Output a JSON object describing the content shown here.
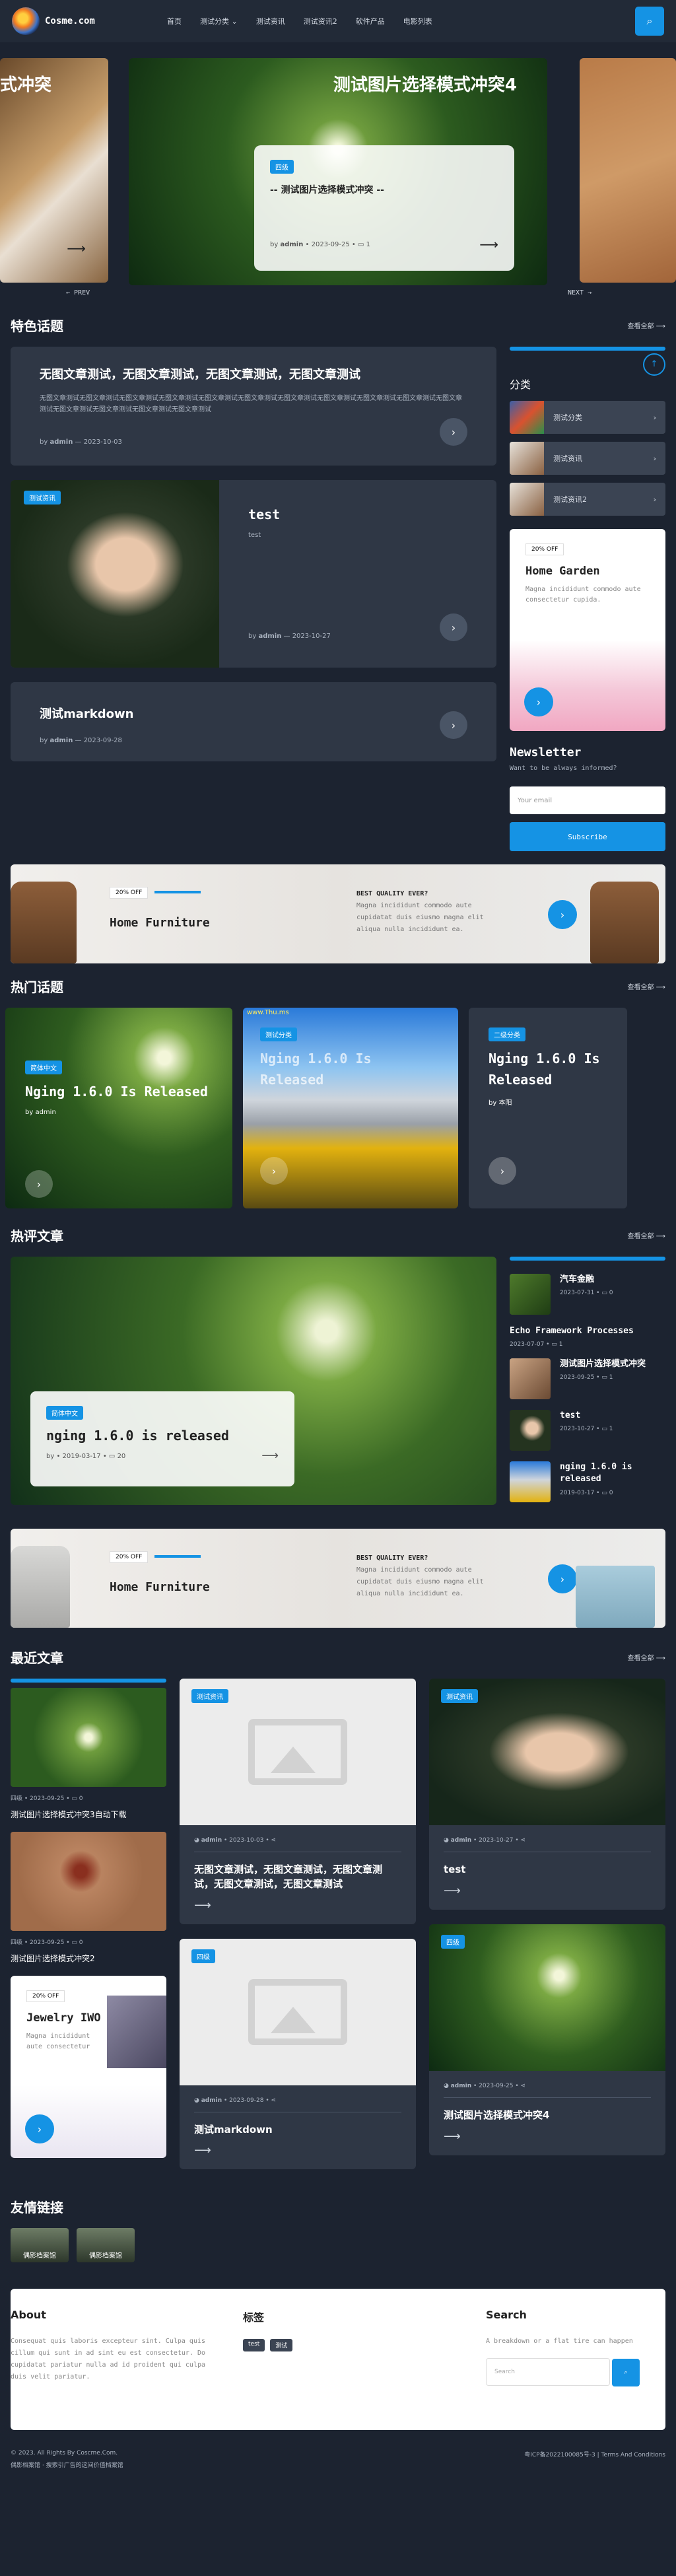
{
  "header": {
    "site_name": "Cosme.com",
    "nav": [
      "首页",
      "测试分类",
      "测试资讯",
      "测试资讯2",
      "软件产品",
      "电影列表"
    ],
    "nav_has_dropdown": [
      false,
      true,
      false,
      false,
      false,
      false
    ]
  },
  "hero": {
    "left_title": "式冲突",
    "title": "测试图片选择模式冲突4",
    "tag": "四级",
    "subtitle": "-- 测试图片选择模式冲突 --",
    "author_prefix": "by",
    "author": "admin",
    "date": "2023-09-25",
    "comments": "1",
    "prev": "← PREV",
    "next": "NEXT →"
  },
  "featured": {
    "heading": "特色话题",
    "view_all": "查看全部",
    "post1": {
      "title": "无图文章测试，无图文章测试，无图文章测试，无图文章测试",
      "excerpt": "无图文章测试无图文章测试无图文章测试无图文章测试无图文章测试无图文章测试无图文章测试无图文章测试无图文章测试无图文章测试无图文章测试无图文章测试无图文章测试无图文章测试无图文章测试",
      "author_prefix": "by",
      "author": "admin",
      "date": "2023-10-03"
    },
    "post2": {
      "tag": "测试资讯",
      "title": "test",
      "excerpt": "test",
      "author_prefix": "by",
      "author": "admin",
      "date": "2023-10-27"
    },
    "post3": {
      "title": "测试markdown",
      "author_prefix": "by",
      "author": "admin",
      "date": "2023-09-28"
    }
  },
  "sidebar": {
    "category_title": "分类",
    "categories": [
      "测试分类",
      "测试资讯",
      "测试资讯2"
    ],
    "promo": {
      "badge": "20% OFF",
      "title": "Home Garden",
      "text": "Magna incididunt commodo aute consectetur cupida."
    },
    "newsletter": {
      "title": "Newsletter",
      "text": "Want to be always informed?",
      "placeholder": "Your email",
      "button": "Subscribe"
    }
  },
  "banner1": {
    "badge": "20% OFF",
    "title": "Home Furniture",
    "label": "BEST QUALITY EVER?",
    "text1": "Magna incididunt commodo aute",
    "text2": "cupidatat duis eiusmo magna elit",
    "text3": "aliqua nulla incididunt ea."
  },
  "hot": {
    "heading": "热门话题",
    "view_all": "查看全部",
    "items": [
      {
        "tag": "简体中文",
        "title": "Nging 1.6.0 Is Released",
        "by": "by",
        "author": "admin"
      },
      {
        "tag": "测试分类",
        "title": "Nging 1.6.0 Is Released",
        "by": "",
        "author": ""
      },
      {
        "tag": "二级分类",
        "title": "Nging 1.6.0 Is Released",
        "by": "by",
        "author": "本阳"
      }
    ],
    "watermark": "www.Thu.ms"
  },
  "trending": {
    "heading": "热评文章",
    "view_all": "查看全部",
    "main": {
      "tag": "简体中文",
      "title": "nging 1.6.0 is released",
      "by": "by",
      "date": "2019-03-17",
      "comments": "20"
    },
    "list": [
      {
        "title": "汽车金融",
        "date": "2023-07-31",
        "comments": "0"
      },
      {
        "title": "Echo Framework Processes",
        "date": "2023-07-07",
        "comments": "1"
      },
      {
        "title": "测试图片选择模式冲突",
        "date": "2023-09-25",
        "comments": "1"
      },
      {
        "title": "test",
        "date": "2023-10-27",
        "comments": "1"
      },
      {
        "title": "nging 1.6.0 is released",
        "date": "2019-03-17",
        "comments": "0"
      }
    ]
  },
  "banner2": {
    "badge": "20% OFF",
    "title": "Home Furniture",
    "label": "BEST QUALITY EVER?",
    "text1": "Magna incididunt commodo aute",
    "text2": "cupidatat duis eiusmo magna elit",
    "text3": "aliqua nulla incididunt ea."
  },
  "recent": {
    "heading": "最近文章",
    "view_all": "查看全部",
    "left": [
      {
        "cat": "四级",
        "date": "2023-09-25",
        "comments": "0",
        "title": "测试图片选择模式冲突3自动下载"
      },
      {
        "cat": "四级",
        "date": "2023-09-25",
        "comments": "0",
        "title": "测试图片选择模式冲突2"
      }
    ],
    "promo": {
      "badge": "20% OFF",
      "title": "Jewelry IWO",
      "text1": "Magna incididunt",
      "text2": "aute consectetur"
    },
    "cards": [
      {
        "tag": "测试资讯",
        "author": "admin",
        "date": "2023-10-03",
        "title": "无图文章测试，无图文章测试，无图文章测试，无图文章测试，无图文章测试"
      },
      {
        "tag": "测试资讯",
        "author": "admin",
        "date": "2023-10-27",
        "title": "test"
      },
      {
        "tag": "四级",
        "author": "admin",
        "date": "2023-09-28",
        "title": "测试markdown"
      },
      {
        "tag": "四级",
        "author": "admin",
        "date": "2023-09-25",
        "title": "测试图片选择模式冲突4"
      }
    ]
  },
  "links": {
    "heading": "友情链接",
    "items": [
      "偶影档案馆",
      "偶影档案馆"
    ]
  },
  "footer": {
    "about_title": "About",
    "about_text": "Consequat quis laboris excepteur sint. Culpa quis cillum qui sunt in ad sint eu est consectetur. Do cupidatat pariatur nulla ad id proident qui culpa duis velit pariatur.",
    "tags_title": "标签",
    "tags": [
      "test",
      "测试"
    ],
    "search_title": "Search",
    "search_text": "A breakdown or a flat tire can happen",
    "search_placeholder": "Search",
    "copyright": "© 2023. All Rights By Coscme.Com.",
    "beian": "偶影档案馆 · 搜索引广告的这间价值档案馆",
    "icp": "粤ICP备2022100085号-3",
    "terms": "Terms And Conditions"
  }
}
